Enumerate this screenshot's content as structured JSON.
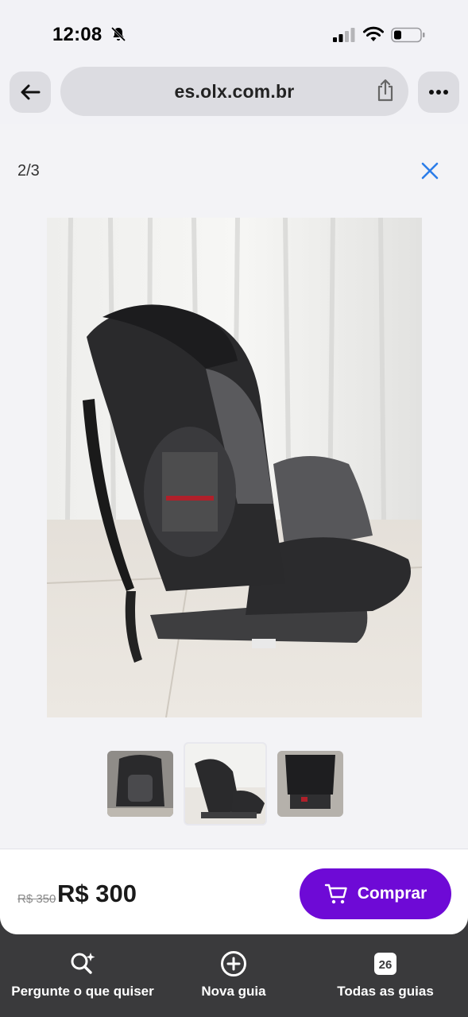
{
  "status_bar": {
    "time": "12:08"
  },
  "browser": {
    "url": "es.olx.com.br"
  },
  "gallery": {
    "counter": "2/3",
    "thumbnails": [
      "thumb-1",
      "thumb-2",
      "thumb-3"
    ],
    "selected_thumbnail": 2
  },
  "listing": {
    "old_price": "R$ 350",
    "price": "R$ 300",
    "buy_label": "Comprar"
  },
  "toolbar": {
    "ask_label": "Pergunte o que quiser",
    "new_tab_label": "Nova guia",
    "all_tabs_label": "Todas as guias",
    "tab_count": "26"
  },
  "colors": {
    "accent": "#6e0ad6",
    "close_icon": "#2b7de9"
  }
}
